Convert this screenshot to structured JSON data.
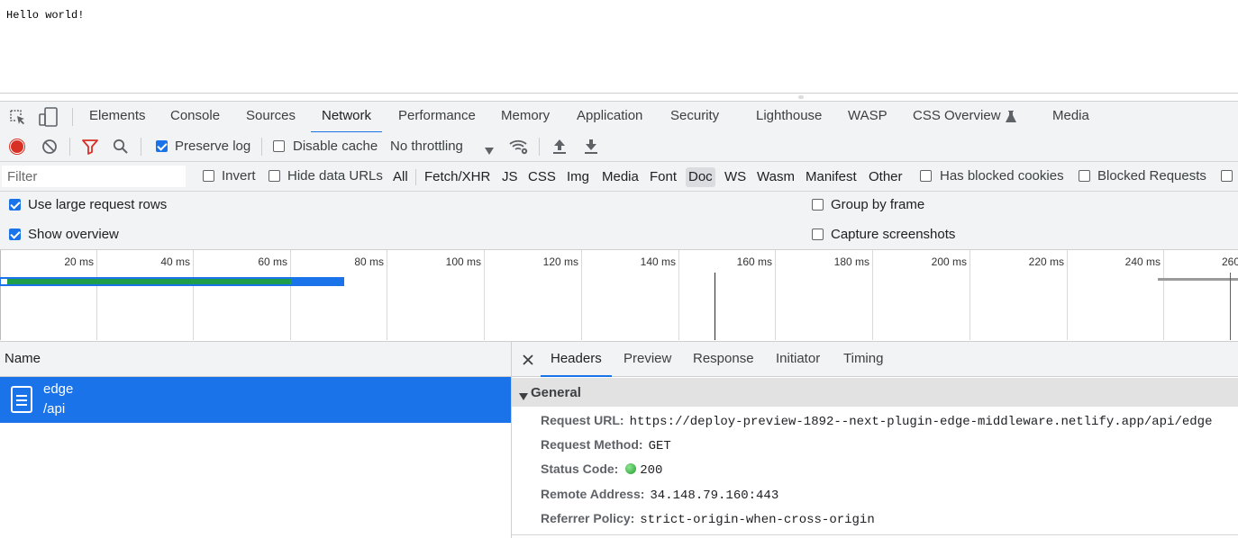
{
  "page": {
    "body_text": "Hello world!"
  },
  "devtools": {
    "tabs": [
      "Elements",
      "Console",
      "Sources",
      "Network",
      "Performance",
      "Memory",
      "Application",
      "Security",
      "Lighthouse",
      "WASP",
      "CSS Overview",
      "Media"
    ],
    "active_tab": "Network",
    "toolbar": {
      "preserve_log": "Preserve log",
      "preserve_log_checked": true,
      "disable_cache": "Disable cache",
      "throttling": "No throttling"
    },
    "filter": {
      "placeholder": "Filter",
      "invert": "Invert",
      "hide_data_urls": "Hide data URLs",
      "types": [
        "All",
        "Fetch/XHR",
        "JS",
        "CSS",
        "Img",
        "Media",
        "Font",
        "Doc",
        "WS",
        "Wasm",
        "Manifest",
        "Other"
      ],
      "active_type": "Doc",
      "has_blocked_cookies": "Has blocked cookies",
      "blocked_requests": "Blocked Requests"
    },
    "settings": {
      "use_large_rows": "Use large request rows",
      "show_overview": "Show overview",
      "group_by_frame": "Group by frame",
      "capture_screenshots": "Capture screenshots"
    },
    "overview": {
      "tick_labels": [
        "20 ms",
        "40 ms",
        "60 ms",
        "80 ms",
        "100 ms",
        "120 ms",
        "140 ms",
        "160 ms",
        "180 ms",
        "200 ms",
        "220 ms",
        "240 ms",
        "260"
      ]
    },
    "requests": {
      "column_name": "Name",
      "rows": [
        {
          "name": "edge",
          "path": "/api"
        }
      ]
    },
    "details": {
      "tabs": [
        "Headers",
        "Preview",
        "Response",
        "Initiator",
        "Timing"
      ],
      "active_tab": "Headers",
      "section": "General",
      "fields": {
        "request_url_key": "Request URL:",
        "request_url": "https://deploy-preview-1892--next-plugin-edge-middleware.netlify.app/api/edge",
        "request_method_key": "Request Method:",
        "request_method": "GET",
        "status_code_key": "Status Code:",
        "status_code": "200",
        "remote_address_key": "Remote Address:",
        "remote_address": "34.148.79.160:443",
        "referrer_policy_key": "Referrer Policy:",
        "referrer_policy": "strict-origin-when-cross-origin"
      }
    },
    "colors": {
      "accent": "#1a73e8",
      "record": "#d93025",
      "filter_icon": "#d93025",
      "status_ok": "#2ea043"
    }
  }
}
